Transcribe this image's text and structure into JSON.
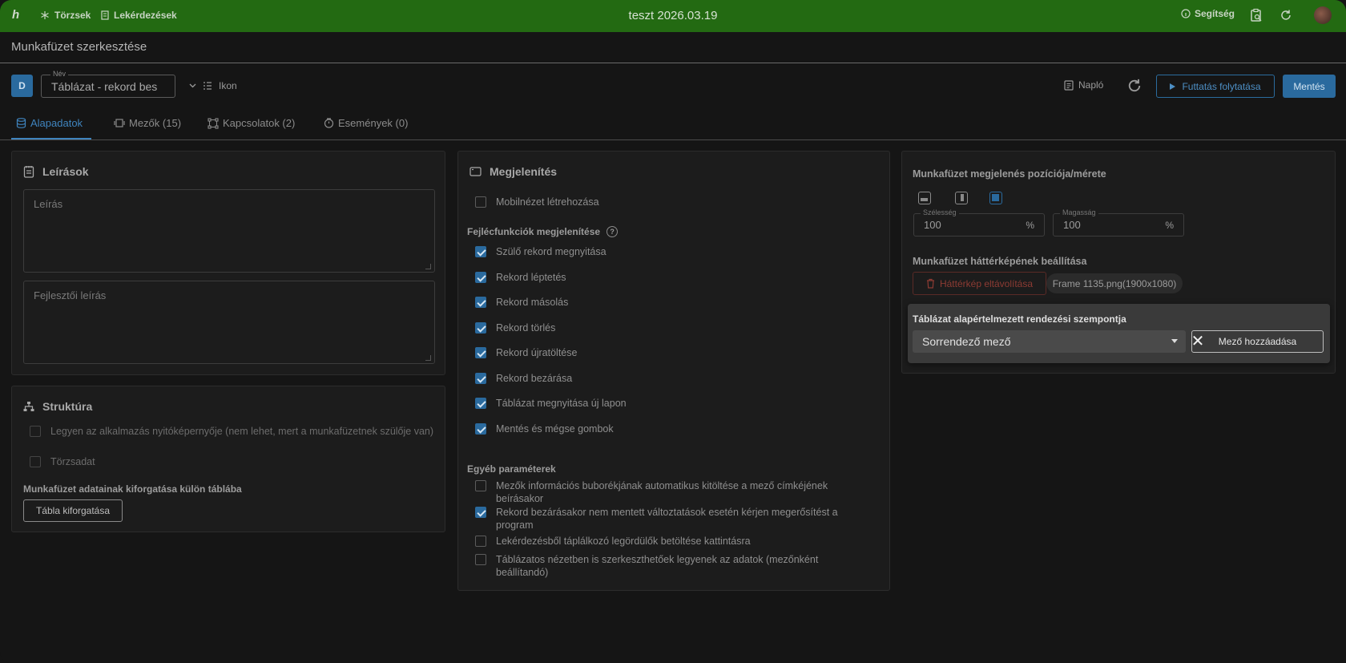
{
  "topbar": {
    "logo": "h",
    "nav_1": "Törzsek",
    "nav_2": "Lekérdezések",
    "title": "teszt 2026.03.19",
    "help": "Segítség"
  },
  "page": {
    "title": "Munkafüzet szerkesztése"
  },
  "toolbar": {
    "badge": "D",
    "name_label": "Név",
    "name_value": "Táblázat - rekord bes",
    "icon_label": "Ikon",
    "log_label": "Napló",
    "run_label": "Futtatás folytatása",
    "save_label": "Mentés"
  },
  "tabs": [
    {
      "label": "Alapadatok",
      "active": true
    },
    {
      "label": "Mezők (15)"
    },
    {
      "label": "Kapcsolatok (2)"
    },
    {
      "label": "Események (0)"
    }
  ],
  "descriptions": {
    "title": "Leírások",
    "desc_placeholder": "Leírás",
    "dev_desc_placeholder": "Fejlesztői leírás"
  },
  "structure": {
    "title": "Struktúra",
    "opt1": "Legyen az alkalmazás nyitóképernyője (nem lehet, mert a munkafüzetnek szülője van)",
    "opt2": "Törzsadat",
    "pivot_head": "Munkafüzet adatainak kiforgatása külön táblába",
    "pivot_button": "Tábla kiforgatása"
  },
  "display": {
    "title": "Megjelenítés",
    "mobile": "Mobilnézet létrehozása",
    "header_section": "Fejlécfunkciók megjelenítése",
    "header_items": [
      {
        "label": "Szülő rekord megnyitása",
        "checked": true
      },
      {
        "label": "Rekord léptetés",
        "checked": true
      },
      {
        "label": "Rekord másolás",
        "checked": true
      },
      {
        "label": "Rekord törlés",
        "checked": true
      },
      {
        "label": "Rekord újratöltése",
        "checked": true
      },
      {
        "label": "Rekord bezárása",
        "checked": true
      },
      {
        "label": "Táblázat megnyitása új lapon",
        "checked": true
      },
      {
        "label": "Mentés és mégse gombok",
        "checked": true
      }
    ],
    "other_section": "Egyéb paraméterek",
    "other_items": [
      {
        "label": "Mezők információs buborékjának automatikus kitöltése a mező címkéjének beírásakor",
        "checked": false
      },
      {
        "label": "Rekord bezárásakor nem mentett változtatások esetén kérjen megerősítést a program",
        "checked": true
      },
      {
        "label": "Lekérdezésből táplálkozó legördülők betöltése kattintásra",
        "checked": false
      },
      {
        "label": "Táblázatos nézetben is szerkeszthetőek legyenek az adatok (mezőnként beállítandó)",
        "checked": false
      }
    ]
  },
  "position": {
    "title": "Munkafüzet megjelenés pozíciója/mérete",
    "width_label": "Szélesség",
    "width_value": "100",
    "height_label": "Magasság",
    "height_value": "100",
    "unit": "%",
    "bg_title": "Munkafüzet háttérképének beállítása",
    "bg_remove": "Háttérkép eltávolítása",
    "bg_file": "Frame 1135.png(1900x1080)"
  },
  "sort": {
    "title": "Táblázat alapértelmezett rendezési szempontja",
    "select_value": "Sorrendező mező",
    "clear": "✕",
    "add_button": "Mező hozzáadása"
  },
  "colors": {
    "topbar": "#236a12",
    "accent": "#2a6a9e",
    "danger": "#8d3b33"
  }
}
